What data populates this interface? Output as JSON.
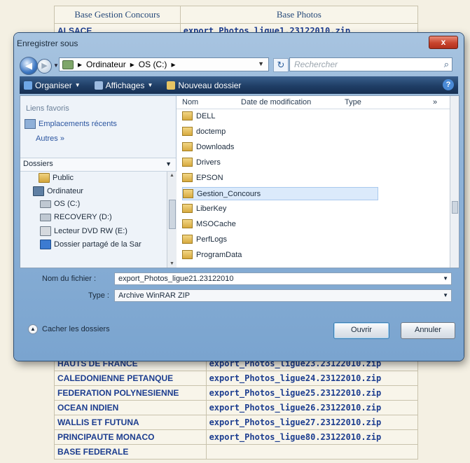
{
  "web_table": {
    "headers": [
      "Base Gestion Concours",
      "Base Photos"
    ],
    "top_rows": [
      [
        "ALSACE",
        "export_Photos_ligue1.23122010.zip"
      ]
    ],
    "bottom_rows": [
      [
        "HAUTS DE FRANCE",
        "export_Photos_ligue23.23122010.zip"
      ],
      [
        "CALEDONIENNE PETANQUE",
        "export_Photos_ligue24.23122010.zip"
      ],
      [
        "FEDERATION POLYNESIENNE",
        "export_Photos_ligue25.23122010.zip"
      ],
      [
        "OCEAN INDIEN",
        "export_Photos_ligue26.23122010.zip"
      ],
      [
        "WALLIS ET FUTUNA",
        "export_Photos_ligue27.23122010.zip"
      ],
      [
        "PRINCIPAUTE MONACO",
        "export_Photos_ligue80.23122010.zip"
      ],
      [
        "BASE FEDERALE",
        ""
      ]
    ]
  },
  "dialog": {
    "title": "Enregistrer sous",
    "close_label": "x",
    "address": {
      "segments": [
        "Ordinateur",
        "OS (C:)"
      ],
      "separator": "▸"
    },
    "search_placeholder": "Rechercher",
    "toolbar": {
      "organize": "Organiser",
      "views": "Affichages",
      "new_folder": "Nouveau dossier"
    },
    "favorites": {
      "title": "Liens favoris",
      "recent": "Emplacements récents",
      "more": "Autres »"
    },
    "folders_title": "Dossiers",
    "tree": [
      {
        "label": "Public",
        "icon": "folder-icon"
      },
      {
        "label": "Ordinateur",
        "icon": "computer-icon"
      },
      {
        "label": "OS (C:)",
        "icon": "drive-icon"
      },
      {
        "label": "RECOVERY (D:)",
        "icon": "drive-icon"
      },
      {
        "label": "Lecteur DVD RW (E:)",
        "icon": "dvd-drive-icon"
      },
      {
        "label": "Dossier partagé de la Sar",
        "icon": "shared-folder-icon"
      }
    ],
    "columns": [
      "Nom",
      "Date de modification",
      "Type"
    ],
    "files": [
      "DELL",
      "doctemp",
      "Downloads",
      "Drivers",
      "EPSON",
      "Gestion_Concours",
      "LiberKey",
      "MSOCache",
      "PerfLogs",
      "ProgramData"
    ],
    "selected_file": "Gestion_Concours",
    "filename_label": "Nom du fichier :",
    "filename_value": "export_Photos_ligue21.23122010",
    "type_label": "Type :",
    "type_value": "Archive WinRAR ZIP",
    "hide_folders": "Cacher les dossiers",
    "save_button": "Ouvrir",
    "cancel_button": "Annuler"
  },
  "colors": {
    "accent": "#1c3d8f",
    "frame": "#8fb3d8",
    "toolbar": "#1f3e66"
  }
}
